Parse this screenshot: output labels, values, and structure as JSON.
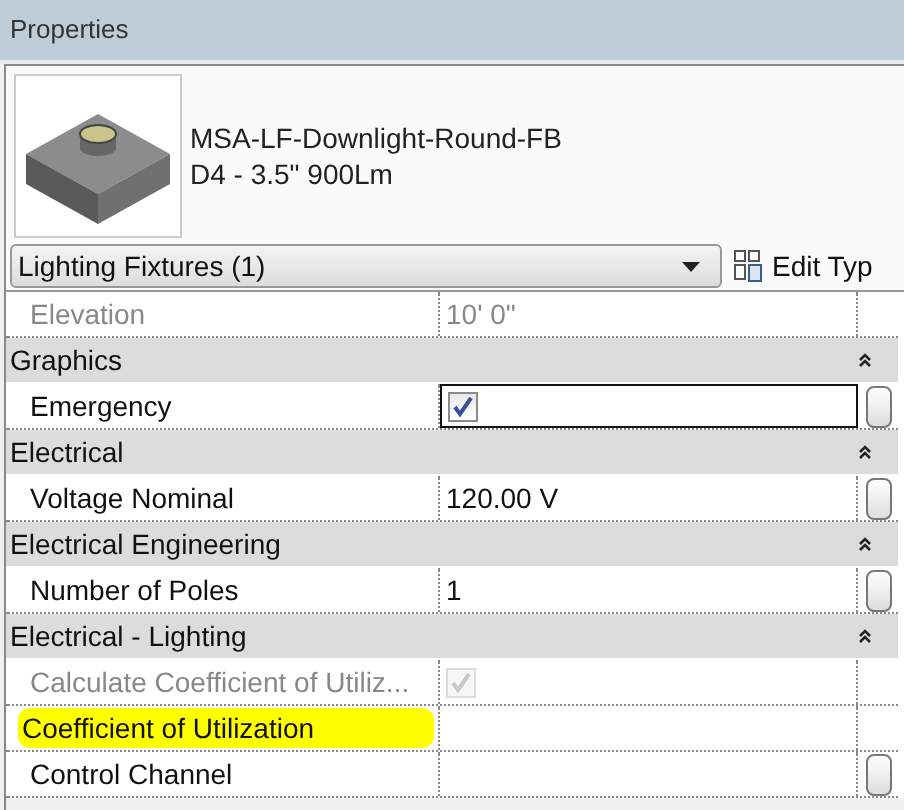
{
  "window": {
    "title": "Properties"
  },
  "type_selector": {
    "family": "MSA-LF-Downlight-Round-FB",
    "type": "D4 - 3.5\" 900Lm"
  },
  "filter": {
    "value": "Lighting Fixtures (1)"
  },
  "edit_type": {
    "label": "Edit Typ"
  },
  "rows": [
    {
      "kind": "param",
      "label": "Elevation",
      "value": "10'  0\"",
      "disabled": true,
      "button": false,
      "focused": false,
      "highlighted": false
    },
    {
      "kind": "group",
      "label": "Graphics"
    },
    {
      "kind": "check",
      "label": "Emergency",
      "checked": true,
      "disabled": false,
      "button": true,
      "focused": true,
      "highlighted": false
    },
    {
      "kind": "group",
      "label": "Electrical"
    },
    {
      "kind": "param",
      "label": "Voltage Nominal",
      "value": "120.00 V",
      "disabled": false,
      "button": true,
      "focused": false,
      "highlighted": false
    },
    {
      "kind": "group",
      "label": "Electrical Engineering"
    },
    {
      "kind": "param",
      "label": "Number of Poles",
      "value": "1",
      "disabled": false,
      "button": true,
      "focused": false,
      "highlighted": false
    },
    {
      "kind": "group",
      "label": "Electrical - Lighting"
    },
    {
      "kind": "check",
      "label": "Calculate Coefficient of Utiliz...",
      "checked": true,
      "disabled": true,
      "button": false,
      "focused": false,
      "highlighted": false
    },
    {
      "kind": "param",
      "label": "Coefficient of Utilization",
      "disabled": false,
      "button": false,
      "focused": false,
      "highlighted": true
    },
    {
      "kind": "param",
      "label": "Control Channel",
      "disabled": false,
      "button": true,
      "focused": false,
      "highlighted": false
    }
  ]
}
